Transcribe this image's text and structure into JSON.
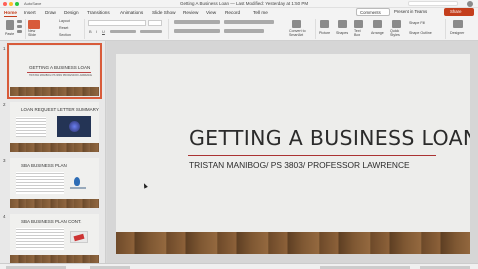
{
  "window": {
    "autosave_label": "AutoSave",
    "title": "Getting A Business Loan — Last Modified: Yesterday at 1:50 PM"
  },
  "ribbon_tabs": [
    "Home",
    "Insert",
    "Draw",
    "Design",
    "Transitions",
    "Animations",
    "Slide Show",
    "Review",
    "View",
    "Record",
    "Tell me"
  ],
  "active_tab": "Home",
  "actions": {
    "comments": "Comments",
    "present": "Present in Teams",
    "share": "Share"
  },
  "ribbon": {
    "paste": "Paste",
    "new_slide": "New Slide",
    "layout": "Layout",
    "reset": "Reset",
    "section": "Section",
    "convert_smartart": "Convert to SmartArt",
    "picture": "Picture",
    "shapes": "Shapes",
    "text_box": "Text Box",
    "arrange": "Arrange",
    "quick_styles": "Quick Styles",
    "shape_fill": "Shape Fill",
    "shape_outline": "Shape Outline",
    "designer": "Designer"
  },
  "slides": [
    {
      "number": "1",
      "title": "GETTING A BUSINESS LOAN",
      "subtitle": "TRISTAN MANIBOG/ PS 3803/ PROFESSOR LAWRENCE",
      "selected": true
    },
    {
      "number": "2",
      "title": "LOAN REQUEST LETTER SUMMARY"
    },
    {
      "number": "3",
      "title": "SBA BUSINESS PLAN"
    },
    {
      "number": "4",
      "title": "SBA BUSINESS PLAN CONT."
    }
  ],
  "main_slide": {
    "title": "GETTING A BUSINESS LOAN",
    "subtitle": "TRISTAN MANIBOG/ PS 3803/ PROFESSOR LAWRENCE"
  },
  "colors": {
    "accent": "#c43e1c",
    "selection": "#d85b3a",
    "title_rule": "#aa3333"
  }
}
